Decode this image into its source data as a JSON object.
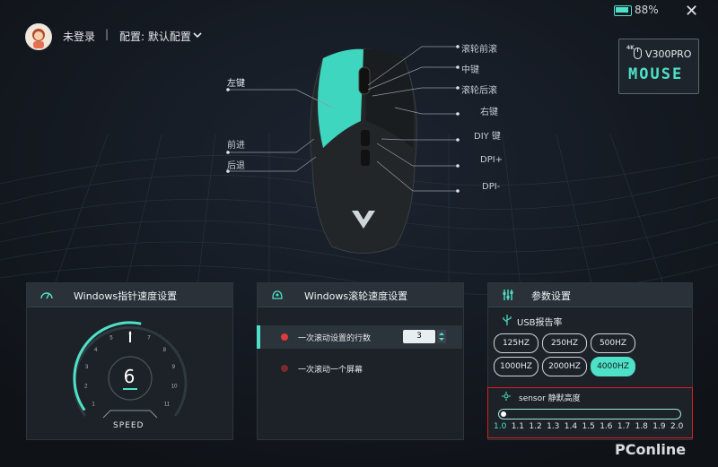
{
  "status": {
    "battery": "88%"
  },
  "user": {
    "login": "未登录",
    "separator": "|",
    "config": "配置: 默认配置"
  },
  "badge": {
    "res": "4K",
    "model": "V300PRO",
    "brand": "MOUSE"
  },
  "labels": {
    "left_button": "左键",
    "forward": "前进",
    "back": "后退",
    "scroll_front": "滚轮前滚",
    "middle": "中键",
    "scroll_back": "滚轮后滚",
    "right_button": "右键",
    "diy": "DIY 键",
    "dpi_plus": "DPI+",
    "dpi_minus": "DPI-"
  },
  "pointer_panel": {
    "title": "Windows指针速度设置",
    "speed_value": "6",
    "speed_label": "SPEED",
    "gauge_level": 6,
    "gauge_max": 11,
    "gauge_ticks": [
      "1",
      "2",
      "3",
      "4",
      "5",
      "6",
      "7",
      "8",
      "9",
      "10",
      "11"
    ]
  },
  "scroll_panel": {
    "title": "Windows滚轮速度设置",
    "rows": [
      {
        "label": "一次滚动设置的行数",
        "value": "3"
      },
      {
        "label": "一次滚动一个屏幕"
      }
    ]
  },
  "params_panel": {
    "title": "参数设置",
    "usb_label": "USB报告率",
    "rates": [
      "125HZ",
      "250HZ",
      "500HZ",
      "1000HZ",
      "2000HZ",
      "4000HZ"
    ],
    "selected_rate": "4000HZ",
    "sensor_title": "sensor 静默高度",
    "sensor_ticks": [
      "1.0",
      "1.1",
      "1.2",
      "1.3",
      "1.4",
      "1.5",
      "1.6",
      "1.7",
      "1.8",
      "1.9",
      "2.0"
    ],
    "sensor_value": "1.0"
  },
  "watermark": "PConline",
  "colors": {
    "accent": "#4fe0c8",
    "highlight_box": "#d81e1e",
    "background": "#12161b"
  }
}
